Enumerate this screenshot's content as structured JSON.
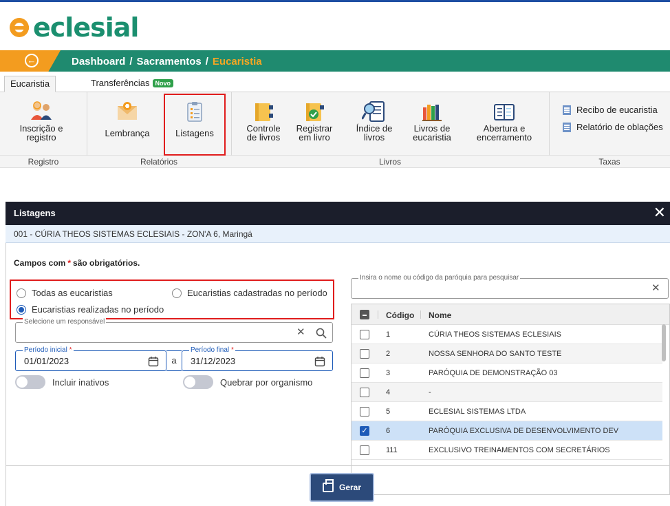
{
  "app": {
    "logo_text": "eclesial",
    "brand_color": "#1b8f6f",
    "accent_color": "#f39c1f"
  },
  "breadcrumb": {
    "items": [
      "Dashboard",
      "Sacramentos"
    ],
    "current": "Eucaristia",
    "separator": "/"
  },
  "tabs": [
    {
      "label": "Eucaristia",
      "active": true
    },
    {
      "label": "Transferências",
      "badge": "Novo"
    }
  ],
  "ribbon": {
    "buttons": [
      {
        "label1": "Inscrição e",
        "label2": "registro",
        "icon": "people-icon"
      },
      {
        "label1": "Lembrança",
        "label2": "",
        "icon": "envelope-icon"
      },
      {
        "label1": "Listagens",
        "label2": "",
        "icon": "clipboard-list-icon"
      },
      {
        "label1": "Controle",
        "label2": "de livros",
        "icon": "book-control-icon"
      },
      {
        "label1": "Registrar",
        "label2": "em livro",
        "icon": "book-check-icon"
      },
      {
        "label1": "Índice de",
        "label2": "livros",
        "icon": "index-search-icon"
      },
      {
        "label1": "Livros de",
        "label2": "eucaristia",
        "icon": "books-icon"
      },
      {
        "label1": "Abertura e",
        "label2": "encerramento",
        "icon": "open-book-icon"
      }
    ],
    "groups": [
      "Registro",
      "Relatórios",
      "Livros",
      "Taxas"
    ],
    "taxas_items": [
      "Recibo de eucaristia",
      "Relatório de oblações"
    ]
  },
  "modal": {
    "title": "Listagens",
    "subtitle": "001 - CÚRIA THEOS SISTEMAS ECLESIAIS - ZON'A 6, Maringá",
    "required_note_pre": "Campos com",
    "required_note_star": "*",
    "required_note_post": "são obrigatórios.",
    "radios": [
      {
        "label": "Todas as eucaristias",
        "checked": false
      },
      {
        "label": "Eucaristias cadastradas no período",
        "checked": false
      },
      {
        "label": "Eucaristias realizadas no período",
        "checked": true
      }
    ],
    "responsavel": {
      "legend": "Selecione um responsável",
      "value": ""
    },
    "periodo_inicial": {
      "legend": "Período inicial",
      "star": "*",
      "value": "01/01/2023"
    },
    "range_sep": "a",
    "periodo_final": {
      "legend": "Período final",
      "star": "*",
      "value": "31/12/2023"
    },
    "toggles": [
      {
        "label": "Incluir inativos",
        "on": false
      },
      {
        "label": "Quebrar por organismo",
        "on": false
      }
    ],
    "search": {
      "legend": "Insira o nome ou código da paróquia para pesquisar",
      "value": ""
    },
    "table": {
      "headers": [
        "Código",
        "Nome"
      ],
      "rows": [
        {
          "codigo": "1",
          "nome": "CÚRIA THEOS SISTEMAS ECLESIAIS",
          "checked": false
        },
        {
          "codigo": "2",
          "nome": "NOSSA SENHORA DO SANTO TESTE",
          "checked": false
        },
        {
          "codigo": "3",
          "nome": "PARÓQUIA DE DEMONSTRAÇÃO 03",
          "checked": false
        },
        {
          "codigo": "4",
          "nome": "-",
          "checked": false
        },
        {
          "codigo": "5",
          "nome": "ECLESIAL SISTEMAS LTDA",
          "checked": false
        },
        {
          "codigo": "6",
          "nome": "PARÓQUIA EXCLUSIVA DE DESENVOLVIMENTO DEV",
          "checked": true
        },
        {
          "codigo": "111",
          "nome": "EXCLUSIVO TREINAMENTOS COM SECRETÁRIOS",
          "checked": false
        }
      ]
    },
    "gerar_label": "Gerar"
  }
}
